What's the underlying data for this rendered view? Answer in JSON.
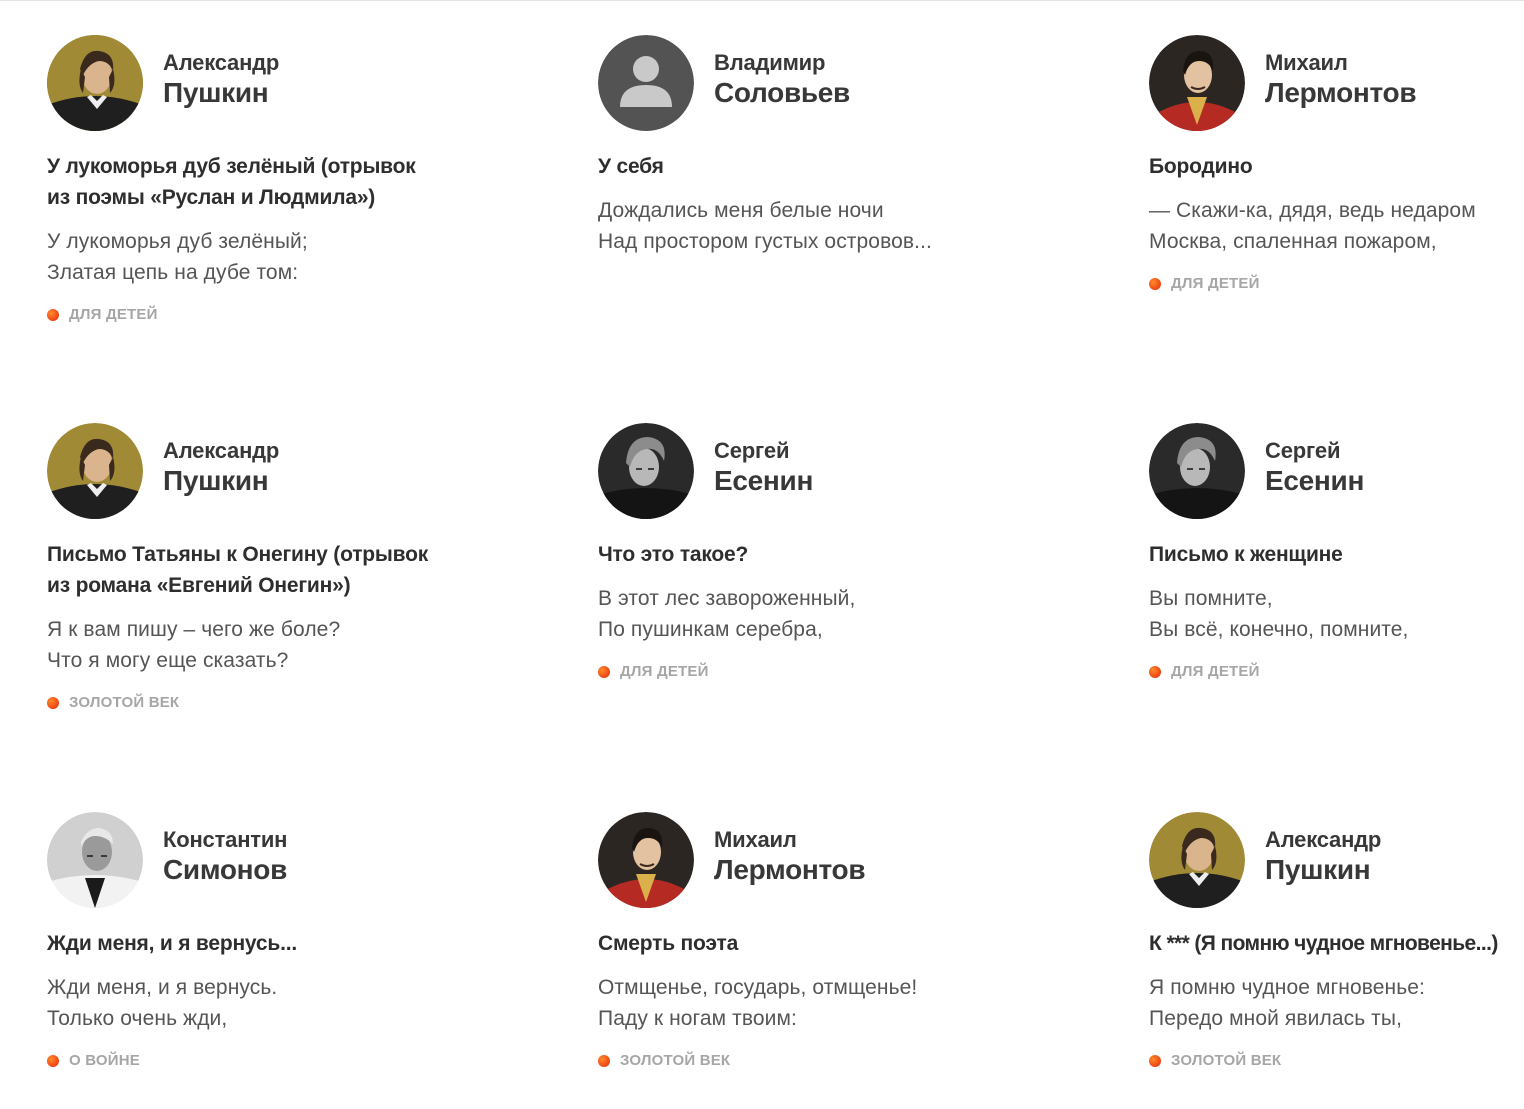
{
  "colors": {
    "accent_dot": "#e8240c",
    "title_text": "#2e2e2e",
    "body_text": "#555555",
    "tag_text": "#a6a6a6"
  },
  "cards": [
    {
      "author_first": "Александр",
      "author_last": "Пушкин",
      "avatar": "pushkin-portrait",
      "title_lines": [
        "У лукоморья дуб зелёный (отрывок",
        "из поэмы «Руслан и Людмила»)"
      ],
      "excerpt": [
        "У лукоморья дуб зелёный;",
        "Златая цепь на дубе том:"
      ],
      "tag": "ДЛЯ ДЕТЕЙ"
    },
    {
      "author_first": "Владимир",
      "author_last": "Соловьев",
      "avatar": "user-placeholder-icon",
      "title_lines": [
        "У себя"
      ],
      "excerpt": [
        "Дождались меня белые ночи",
        "Над простором густых островов..."
      ],
      "tag": ""
    },
    {
      "author_first": "Михаил",
      "author_last": "Лермонтов",
      "avatar": "lermontov-portrait",
      "title_lines": [
        "Бородино"
      ],
      "excerpt": [
        "— Скажи-ка, дядя, ведь недаром",
        "Москва, спаленная пожаром,"
      ],
      "tag": "ДЛЯ ДЕТЕЙ"
    },
    {
      "author_first": "Александр",
      "author_last": "Пушкин",
      "avatar": "pushkin-portrait",
      "title_lines": [
        "Письмо Татьяны к Онегину (отрывок",
        "из романа «Евгений Онегин»)"
      ],
      "excerpt": [
        "Я к вам пишу – чего же боле?",
        "Что я могу еще сказать?"
      ],
      "tag": "ЗОЛОТОЙ ВЕК"
    },
    {
      "author_first": "Сергей",
      "author_last": "Есенин",
      "avatar": "yesenin-portrait",
      "title_lines": [
        "Что это такое?"
      ],
      "excerpt": [
        "В этот лес завороженный,",
        "По пушинкам серебра,"
      ],
      "tag": "ДЛЯ ДЕТЕЙ"
    },
    {
      "author_first": "Сергей",
      "author_last": "Есенин",
      "avatar": "yesenin-portrait",
      "title_lines": [
        "Письмо к женщине"
      ],
      "excerpt": [
        "Вы помните,",
        "Вы всё, конечно, помните,"
      ],
      "tag": "ДЛЯ ДЕТЕЙ"
    },
    {
      "author_first": "Константин",
      "author_last": "Симонов",
      "avatar": "simonov-portrait",
      "title_lines": [
        "Жди меня, и я вернусь..."
      ],
      "excerpt": [
        "Жди меня, и я вернусь.",
        "Только очень жди,"
      ],
      "tag": "О ВОЙНЕ"
    },
    {
      "author_first": "Михаил",
      "author_last": "Лермонтов",
      "avatar": "lermontov-portrait",
      "title_lines": [
        "Смерть поэта"
      ],
      "excerpt": [
        "Отмщенье, государь, отмщенье!",
        "Паду к ногам твоим:"
      ],
      "tag": "ЗОЛОТОЙ ВЕК"
    },
    {
      "author_first": "Александр",
      "author_last": "Пушкин",
      "avatar": "pushkin-portrait",
      "title_lines": [
        "К *** (Я помню чудное мгновенье...)"
      ],
      "excerpt": [
        "Я помню чудное мгновенье:",
        "Передо мной явилась ты,"
      ],
      "tag": "ЗОЛОТОЙ ВЕК"
    }
  ]
}
